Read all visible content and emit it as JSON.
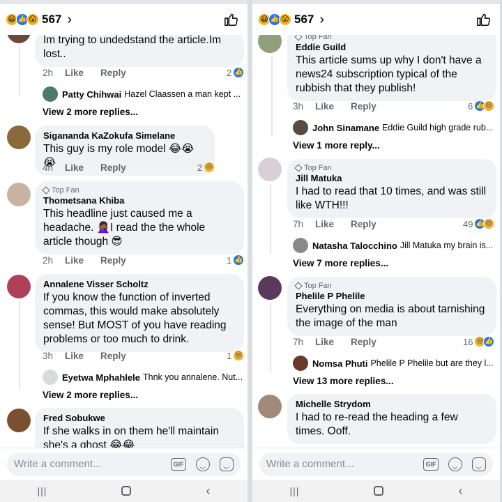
{
  "left": {
    "header": {
      "count": "567"
    },
    "comments": [
      {
        "text": "Im trying to undedstand the article.Im lost..",
        "time": "2h",
        "like": "Like",
        "reply": "Reply",
        "reactions": "2",
        "reaction_types": [
          "like"
        ],
        "reply_preview": {
          "name": "Patty Chihwai",
          "snippet": "Hazel Claassen a man kept ..."
        },
        "more": "View 2 more replies..."
      },
      {
        "author": "Sigananda KaZokufa Simelane",
        "text": "This guy is my role model 😂😭😭",
        "time": "4h",
        "like": "Like",
        "reply": "Reply",
        "reactions": "2",
        "reaction_types": [
          "haha"
        ]
      },
      {
        "badge": "Top Fan",
        "author": "Thometsana Khiba",
        "text": "This headline just caused me a headache. 🤦🏾‍♀️I read the the whole article though 😎",
        "time": "2h",
        "like": "Like",
        "reply": "Reply",
        "reactions": "1",
        "reaction_types": [
          "like"
        ]
      },
      {
        "author": "Annalene Visser Scholtz",
        "text": "If you know the function of inverted commas, this would make absolutely sense!  But MOST of you have reading problems or too much to drink.",
        "time": "3h",
        "like": "Like",
        "reply": "Reply",
        "reactions": "1",
        "reaction_types": [
          "haha"
        ],
        "reply_preview": {
          "name": "Eyetwa Mphahlele",
          "snippet": "Thnk you annalene. Nut..."
        },
        "more": "View 2 more replies..."
      },
      {
        "author": "Fred Sobukwe",
        "text": "If she walks in on them he'll maintain she's a ghost 😂😂"
      }
    ],
    "composer": {
      "placeholder": "Write a comment...",
      "gif": "GIF"
    }
  },
  "right": {
    "header": {
      "count": "567"
    },
    "comments": [
      {
        "badge": "Top Fan",
        "author": "Eddie Guild",
        "text": "This article sums up why I don't have a news24 subscription typical of the rubbish that they publish!",
        "time": "3h",
        "like": "Like",
        "reply": "Reply",
        "reactions": "6",
        "reaction_types": [
          "like",
          "haha"
        ],
        "reply_preview": {
          "name": "John Sinamane",
          "snippet": "Eddie Guild high grade rub..."
        },
        "more": "View 1 more reply..."
      },
      {
        "badge": "Top Fan",
        "author": "Jill Matuka",
        "text": "I had to read that 10 times, and was still like WTH!!!",
        "time": "7h",
        "like": "Like",
        "reply": "Reply",
        "reactions": "49",
        "reaction_types": [
          "like",
          "haha"
        ],
        "reply_preview": {
          "name": "Natasha Talocchino",
          "snippet": "Jill Matuka my brain is..."
        },
        "more": "View 7 more replies..."
      },
      {
        "badge": "Top Fan",
        "author": "Phelile P Phelile",
        "text": "Everything on media is about tarnishing the image of the man",
        "time": "7h",
        "like": "Like",
        "reply": "Reply",
        "reactions": "16",
        "reaction_types": [
          "haha",
          "like"
        ],
        "reply_preview": {
          "name": "Nomsa Phuti",
          "snippet": "Phelile P Phelile but are they l..."
        },
        "more": "View 13 more replies..."
      },
      {
        "author": "Michelle Strydom",
        "text": "I had to re-read the heading a few times. Ooff."
      }
    ],
    "composer": {
      "placeholder": "Write a comment...",
      "gif": "GIF"
    }
  },
  "colors": {
    "like_blue": "#1877f2",
    "haha_yellow": "#f7b125",
    "bubble": "#f0f2f5",
    "muted": "#65676b"
  },
  "icons": {
    "header_thumb": "thumbs-up-icon",
    "back_chevron": "chevron-right-icon",
    "nav": [
      "recents-icon",
      "home-icon",
      "back-icon"
    ]
  }
}
